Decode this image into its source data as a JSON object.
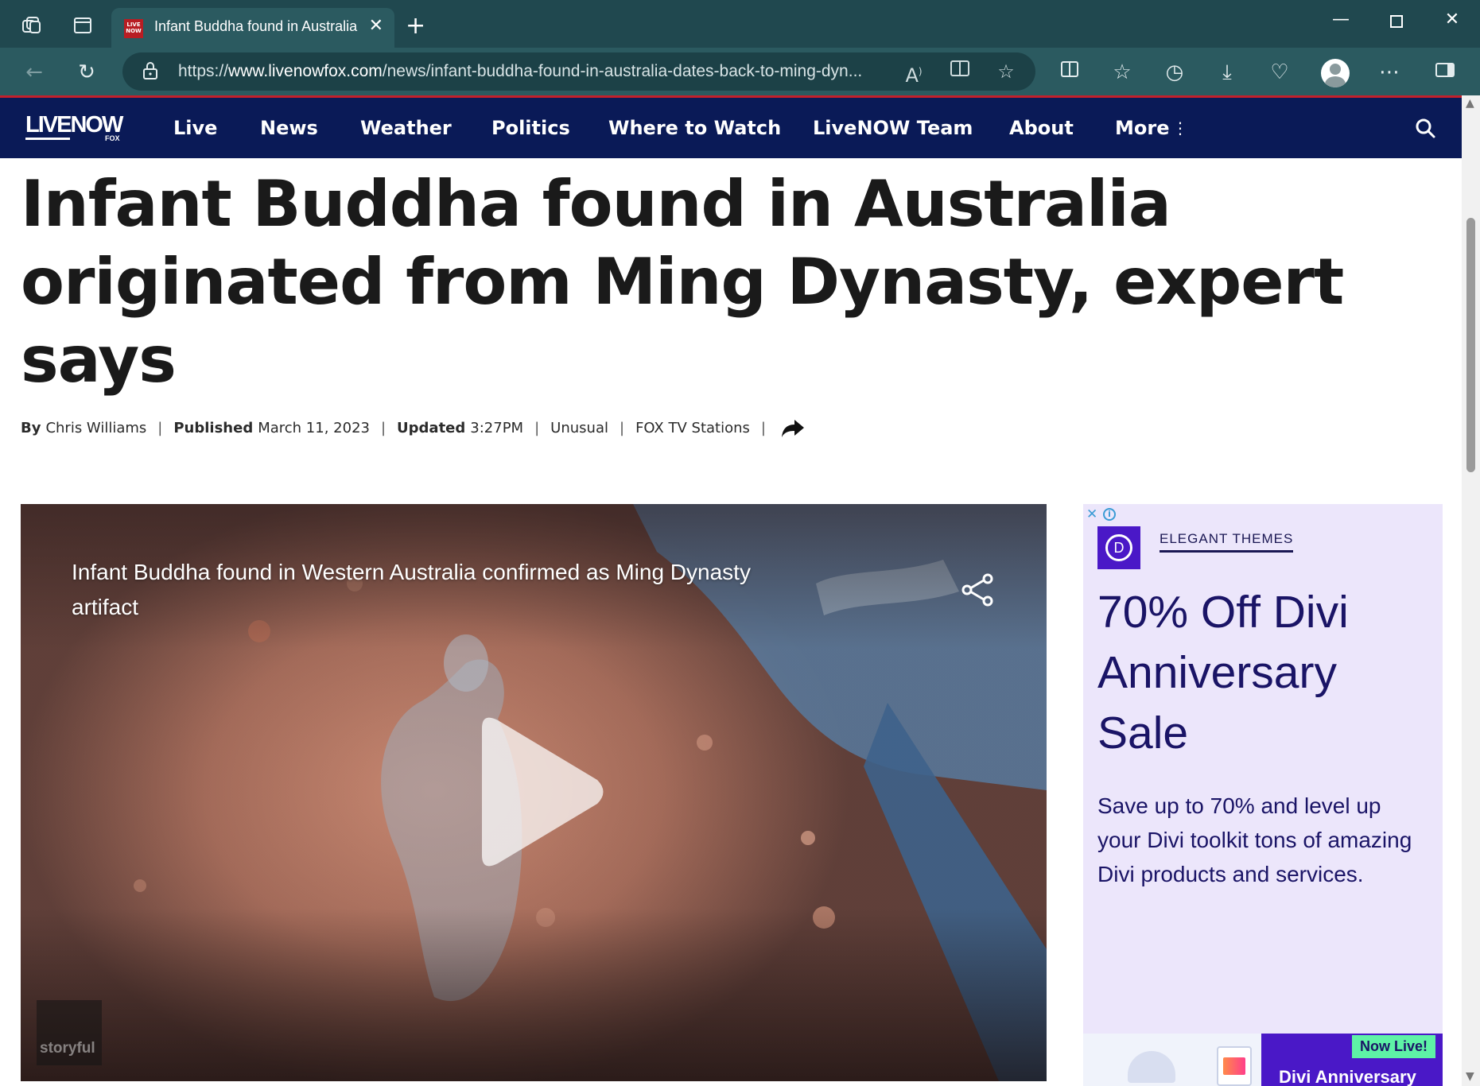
{
  "browser": {
    "tab_title": "Infant Buddha found in Australia",
    "tab_favicon_text": "LIVE NOW",
    "url_host_prefix": "https://",
    "url_host": "www.livenowfox.com",
    "url_path": "/news/infant-buddha-found-in-australia-dates-back-to-ming-dyn...",
    "icons": [
      "workspaces-icon",
      "tab-actions-icon",
      "back-icon",
      "refresh-icon",
      "lock-icon",
      "read-aloud-icon",
      "immersive-reader-icon",
      "favorite-star-icon",
      "split-screen-icon",
      "favorites-icon",
      "history-icon",
      "downloads-icon",
      "browser-essentials-icon",
      "profile-avatar",
      "settings-more-icon",
      "sidebar-icon"
    ]
  },
  "site": {
    "logo_text_live": "LIVE",
    "logo_text_now": "NOW",
    "logo_sub": "FOX",
    "nav": [
      "Live",
      "News",
      "Weather",
      "Politics",
      "Where to Watch",
      "LiveNOW Team",
      "About",
      "More"
    ]
  },
  "article": {
    "headline": "Infant Buddha found in Australia originated from Ming Dynasty, expert says",
    "byline": {
      "by_label": "By",
      "author": "Chris Williams",
      "published_label": "Published",
      "published_date": "March 11, 2023",
      "updated_label": "Updated",
      "updated_time": "3:27PM",
      "category": "Unusual",
      "source": "FOX TV Stations"
    }
  },
  "video": {
    "title": "Infant Buddha found in Western Australia confirmed as Ming Dynasty artifact",
    "watermark": "storyful"
  },
  "ad": {
    "brand": "ELEGANT THEMES",
    "brand_letter": "D",
    "headline": "70% Off Divi Anniversary Sale",
    "body": "Save up to 70% and level up your Divi toolkit tons of amazing Divi products and services.",
    "badge": "Now Live!",
    "banner_text": "Divi Anniversary"
  },
  "colors": {
    "browser_frame": "#20484f",
    "toolbar": "#2b5a60",
    "site_nav": "#0a1a57",
    "accent_red": "#c3202b",
    "ad_background": "#ece6fb",
    "ad_text": "#1a1466",
    "ad_brand_purple": "#4a18c7",
    "now_live_green": "#5ef2a6"
  }
}
